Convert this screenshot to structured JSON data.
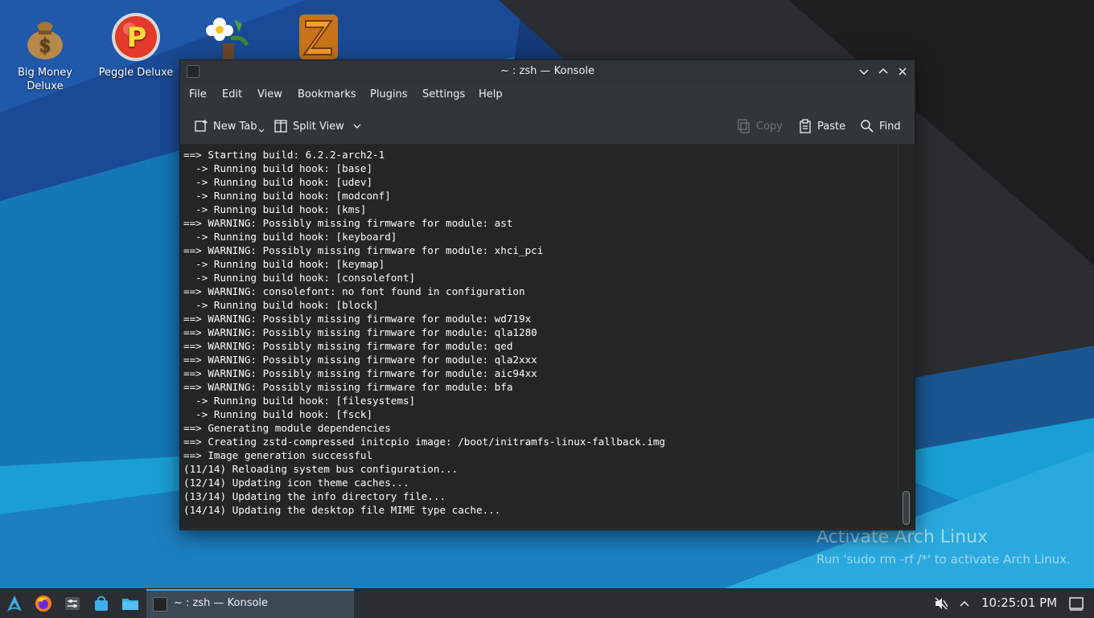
{
  "desktop": {
    "icons": [
      {
        "label_line1": "Big Money",
        "label_line2": "Deluxe"
      },
      {
        "label_line1": "Peggle Deluxe",
        "label_line2": ""
      },
      {
        "label_line1": "",
        "label_line2": ""
      },
      {
        "label_line1": "",
        "label_line2": ""
      }
    ],
    "watermark": {
      "title": "Activate Arch Linux",
      "subtitle": "Run 'sudo rm -rf /*' to activate Arch Linux."
    }
  },
  "window": {
    "title": "~ : zsh — Konsole",
    "menu": [
      "File",
      "Edit",
      "View",
      "Bookmarks",
      "Plugins",
      "Settings",
      "Help"
    ],
    "toolbar": {
      "new_tab": "New Tab",
      "split_view": "Split View",
      "copy": "Copy",
      "paste": "Paste",
      "find": "Find"
    },
    "terminal_lines": [
      "==> Starting build: 6.2.2-arch2-1",
      "  -> Running build hook: [base]",
      "  -> Running build hook: [udev]",
      "  -> Running build hook: [modconf]",
      "  -> Running build hook: [kms]",
      "==> WARNING: Possibly missing firmware for module: ast",
      "  -> Running build hook: [keyboard]",
      "==> WARNING: Possibly missing firmware for module: xhci_pci",
      "  -> Running build hook: [keymap]",
      "  -> Running build hook: [consolefont]",
      "==> WARNING: consolefont: no font found in configuration",
      "  -> Running build hook: [block]",
      "==> WARNING: Possibly missing firmware for module: wd719x",
      "==> WARNING: Possibly missing firmware for module: qla1280",
      "==> WARNING: Possibly missing firmware for module: qed",
      "==> WARNING: Possibly missing firmware for module: qla2xxx",
      "==> WARNING: Possibly missing firmware for module: aic94xx",
      "==> WARNING: Possibly missing firmware for module: bfa",
      "  -> Running build hook: [filesystems]",
      "  -> Running build hook: [fsck]",
      "==> Generating module dependencies",
      "==> Creating zstd-compressed initcpio image: /boot/initramfs-linux-fallback.img",
      "==> Image generation successful",
      "(11/14) Reloading system bus configuration...",
      "(12/14) Updating icon theme caches...",
      "(13/14) Updating the info directory file...",
      "(14/14) Updating the desktop file MIME type cache..."
    ],
    "prompt": "~"
  },
  "taskbar": {
    "task_label": "~ : zsh — Konsole",
    "clock": "10:25:01 PM"
  },
  "colors": {
    "accent": "#3daee9",
    "window_bg": "#31363b",
    "terminal_bg": "#232627"
  }
}
